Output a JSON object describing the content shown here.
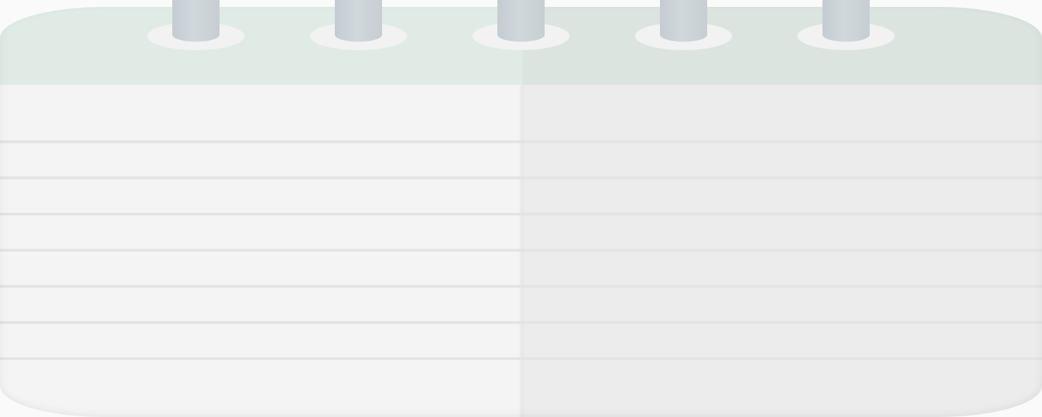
{
  "notepad": {
    "colors": {
      "header": "#e0ebe6",
      "header_right": "#dce4e0",
      "page_left": "#f4f4f4",
      "page_right": "#ececec",
      "rule": "#e4e4e4",
      "ring_post": "#c9d0d5"
    },
    "icons": {
      "binding": "spiral-ring-icon"
    },
    "ring_count": 5,
    "ruled_line_count": 7
  }
}
